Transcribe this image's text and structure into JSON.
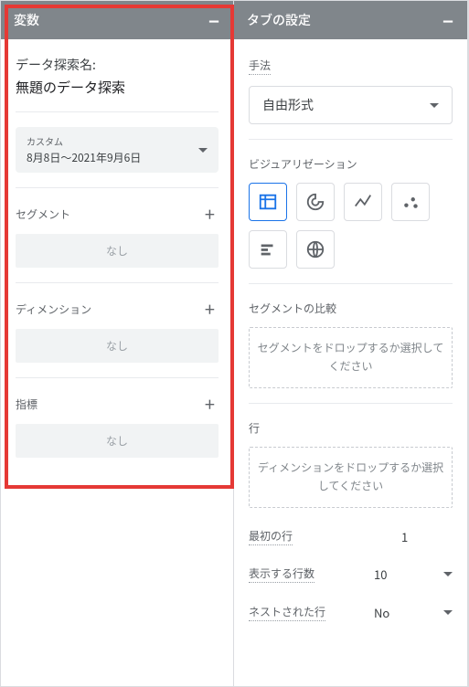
{
  "left": {
    "header": "変数",
    "name_label": "データ探索名:",
    "name_value": "無題のデータ探索",
    "date_custom": "カスタム",
    "date_range": "8月8日～2021年9月6日",
    "segments_label": "セグメント",
    "segments_none": "なし",
    "dimensions_label": "ディメンション",
    "dimensions_none": "なし",
    "metrics_label": "指標",
    "metrics_none": "なし"
  },
  "right": {
    "header": "タブの設定",
    "method_label": "手法",
    "method_value": "自由形式",
    "viz_label": "ビジュアリゼーション",
    "segment_compare_label": "セグメントの比較",
    "segment_drop": "セグメントをドロップするか選択してください",
    "rows_label": "行",
    "rows_drop": "ディメンションをドロップするか選択してください",
    "first_row_label": "最初の行",
    "first_row_value": "1",
    "row_count_label": "表示する行数",
    "row_count_value": "10",
    "nested_label": "ネストされた行",
    "nested_value": "No"
  }
}
